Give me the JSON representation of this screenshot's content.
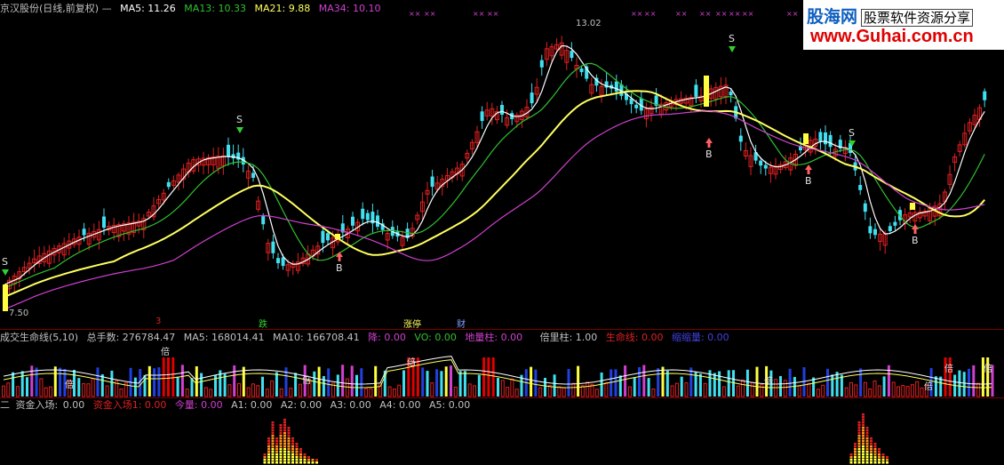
{
  "main_header": {
    "title": "京汉股份(日线,前复权) —",
    "ma5": "MA5: 11.26",
    "ma13": "MA13: 10.33",
    "ma21": "MA21: 9.88",
    "ma34": "MA34: 10.10"
  },
  "volume_header": {
    "name": "成交生命线(5,10)",
    "total": "总手数: 276784.47",
    "ma5": "MA5: 168014.41",
    "ma10": "MA10: 166708.41",
    "jiang": "降: 0.00",
    "vo": "VO: 0.00",
    "dilz": "地量柱: 0.00",
    "beiliang": "倍里柱: 1.00",
    "shengming": "生命线: 0.00",
    "extra": "缩缩量: 0.00"
  },
  "fund_header": {
    "prefix": "二",
    "name": "资金入场:",
    "v1": "0.00",
    "inflow": "资金入场1: 0.00",
    "today": "今量: 0.00",
    "a1": "A1: 0.00",
    "a2": "A2: 0.00",
    "a3": "A3: 0.00",
    "a4": "A4: 0.00",
    "a5": "A5: 0.00"
  },
  "price_labels": {
    "high": "13.02",
    "low": "7.50"
  },
  "bottom_markers": {
    "m1": "3",
    "m2": "跌",
    "m3": "涨停",
    "m4": "财"
  },
  "signals": {
    "sell": "S",
    "buy": "B",
    "bei": "倍"
  },
  "watermark": {
    "brand": "股海网",
    "slogan": "股票软件资源分享",
    "url": "www.Guhai.com.cn"
  },
  "colors": {
    "up": "#e02020",
    "down": "#40e0f0",
    "ma5": "#ffffff",
    "ma13": "#30c030",
    "ma21": "#ffff60",
    "ma34": "#d040d0",
    "buy_arrow": "#ff6060",
    "sell_arrow": "#30d030"
  }
}
